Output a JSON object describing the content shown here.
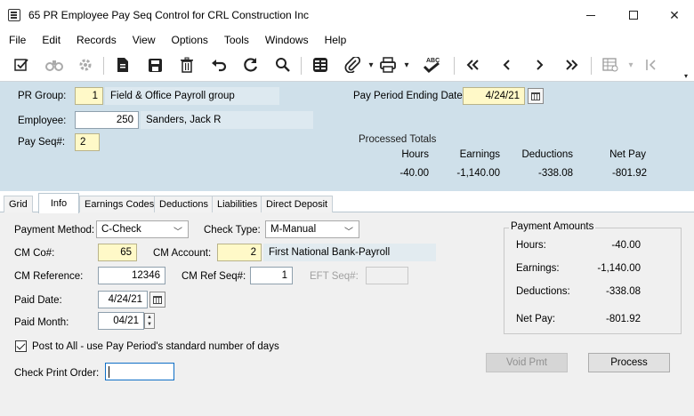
{
  "window": {
    "title": "65 PR Employee Pay Seq Control for CRL Construction Inc",
    "min_icon": "minimize-icon",
    "max_icon": "maximize-icon",
    "close_icon": "close-icon",
    "close_glyph": "✕"
  },
  "menu": [
    "File",
    "Edit",
    "Records",
    "View",
    "Options",
    "Tools",
    "Windows",
    "Help"
  ],
  "toolbar": {
    "icons": [
      "edit-icon",
      "binoculars-icon",
      "settings-icon",
      "new-document-icon",
      "save-icon",
      "delete-icon",
      "undo-icon",
      "refresh-icon",
      "search-icon",
      "grid-icon",
      "attach-icon",
      "print-icon",
      "spellcheck-icon",
      "first-record-icon",
      "previous-record-icon",
      "next-record-icon",
      "last-record-icon",
      "table-options-icon",
      "go-to-icon"
    ]
  },
  "header": {
    "pr_group_label": "PR Group:",
    "pr_group_value": "1",
    "pr_group_desc": "Field & Office Payroll group",
    "employee_label": "Employee:",
    "employee_value": "250",
    "employee_desc": "Sanders, Jack R",
    "pay_seq_label": "Pay Seq#:",
    "pay_seq_value": "2",
    "ppe_label": "Pay Period Ending Date:",
    "ppe_value": "4/24/21",
    "processed_totals_label": "Processed Totals",
    "totals_headers": [
      "Hours",
      "Earnings",
      "Deductions",
      "Net Pay"
    ],
    "totals_values": [
      "-40.00",
      "-1,140.00",
      "-338.08",
      "-801.92"
    ]
  },
  "tabs": [
    "Grid",
    "Info",
    "Earnings Codes",
    "Deductions",
    "Liabilities",
    "Direct Deposit"
  ],
  "active_tab": "Info",
  "info": {
    "payment_method_label": "Payment Method:",
    "payment_method_value": "C-Check",
    "check_type_label": "Check Type:",
    "check_type_value": "M-Manual",
    "cm_co_label": "CM Co#:",
    "cm_co_value": "65",
    "cm_account_label": "CM Account:",
    "cm_account_value": "2",
    "cm_account_desc": "First National Bank-Payroll",
    "cm_reference_label": "CM Reference:",
    "cm_reference_value": "12346",
    "cm_ref_seq_label": "CM Ref Seq#:",
    "cm_ref_seq_value": "1",
    "eft_seq_label": "EFT Seq#:",
    "eft_seq_value": "",
    "paid_date_label": "Paid Date:",
    "paid_date_value": "4/24/21",
    "paid_month_label": "Paid Month:",
    "paid_month_value": "04/21",
    "post_to_all_label": "Post to All - use Pay Period's standard number of days",
    "post_to_all_checked": true,
    "check_print_order_label": "Check Print Order:",
    "check_print_order_value": ""
  },
  "payment_amounts": {
    "title": "Payment Amounts",
    "rows": [
      {
        "label": "Hours:",
        "value": "-40.00"
      },
      {
        "label": "Earnings:",
        "value": "-1,140.00"
      },
      {
        "label": "Deductions:",
        "value": "-338.08"
      },
      {
        "label": "Net Pay:",
        "value": "-801.92"
      }
    ]
  },
  "buttons": {
    "void_pmt": "Void Pmt",
    "process": "Process"
  }
}
